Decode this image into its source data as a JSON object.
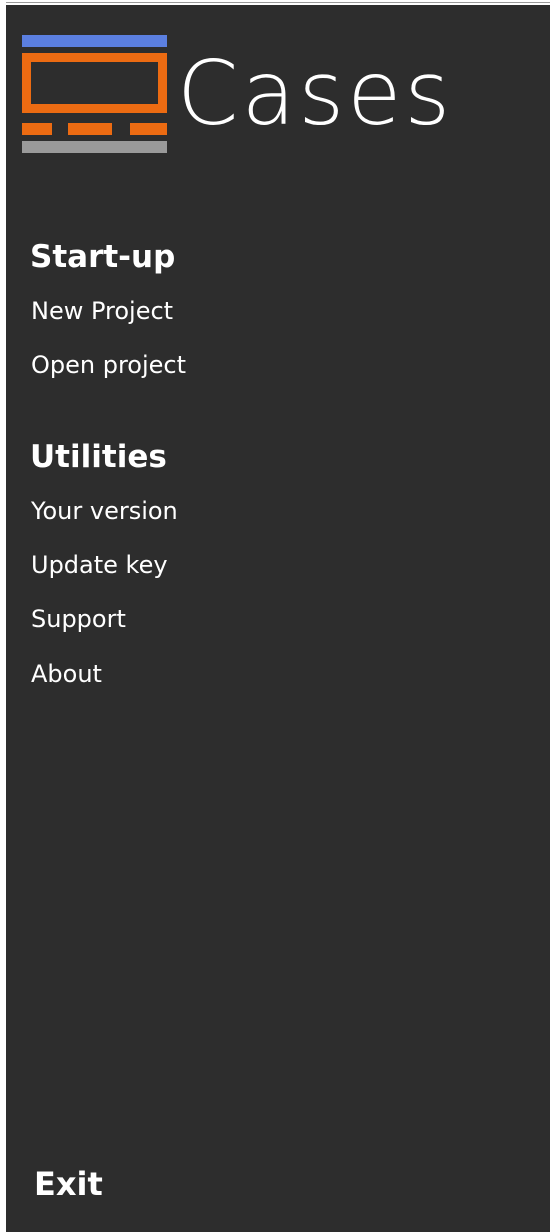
{
  "app": {
    "name": "Cases",
    "brand_colors": {
      "blue": "#5b7fe0",
      "orange": "#ec6b12",
      "gray": "#9a9a9a",
      "background": "#2d2d2d"
    }
  },
  "sections": [
    {
      "title": "Start-up",
      "items": [
        "New Project",
        "Open project"
      ]
    },
    {
      "title": "Utilities",
      "items": [
        "Your version",
        "Update key",
        "Support",
        "About"
      ]
    }
  ],
  "footer": {
    "exit_label": "Exit"
  }
}
